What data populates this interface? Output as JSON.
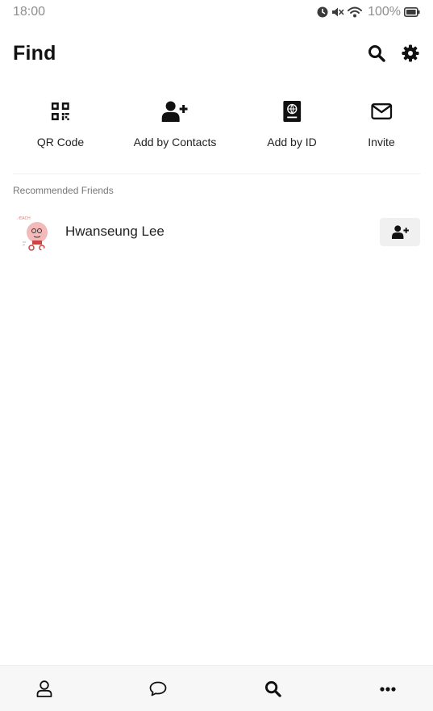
{
  "status_bar": {
    "time": "18:00",
    "battery_percent": "100%",
    "icons": [
      "alarm-icon",
      "mute-icon",
      "wifi-icon",
      "battery-icon"
    ]
  },
  "header": {
    "title": "Find",
    "actions": [
      "search-icon",
      "gear-icon"
    ]
  },
  "quick_actions": [
    {
      "label": "QR Code",
      "icon": "qr-code-icon"
    },
    {
      "label": "Add by Contacts",
      "icon": "add-user-icon"
    },
    {
      "label": "Add by ID",
      "icon": "id-book-icon"
    },
    {
      "label": "Invite",
      "icon": "envelope-icon"
    }
  ],
  "recommended": {
    "section_label": "Recommended Friends",
    "friends": [
      {
        "name": "Hwanseung Lee",
        "avatar": "avatar-character",
        "action_icon": "add-user-icon"
      }
    ]
  },
  "bottom_nav": {
    "items": [
      {
        "name": "friends",
        "icon": "person-icon"
      },
      {
        "name": "chats",
        "icon": "chat-bubble-icon"
      },
      {
        "name": "find",
        "icon": "search-icon",
        "active": true
      },
      {
        "name": "more",
        "icon": "more-dots-icon"
      }
    ]
  },
  "colors": {
    "text_primary": "#111111",
    "status_text": "#8e8e8e",
    "section_label": "#777777",
    "button_bg": "#f0f0f0",
    "nav_bg": "#f7f7f7"
  }
}
